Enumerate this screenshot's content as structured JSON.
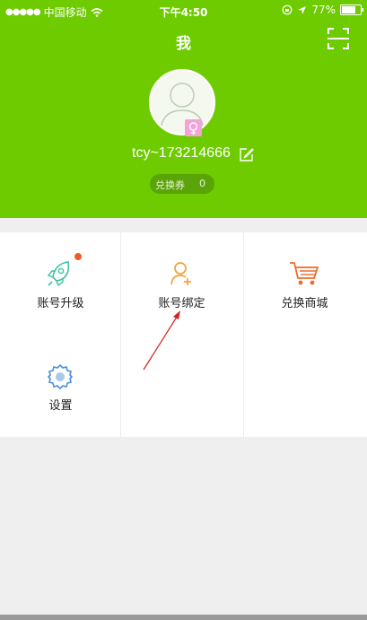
{
  "status_bar": {
    "carrier": "中国移动",
    "time": "下午4:50",
    "battery": "77%",
    "battery_level": 0.77
  },
  "header": {
    "title": "我",
    "username": "tcy~173214666",
    "coupon_label": "兑换券",
    "coupon_value": "0"
  },
  "menu": {
    "items": [
      {
        "label": "账号升级",
        "icon": "rocket-icon",
        "has_badge": true
      },
      {
        "label": "账号绑定",
        "icon": "add-user-icon"
      },
      {
        "label": "兑换商城",
        "icon": "shopping-cart-icon"
      },
      {
        "label": "设置",
        "icon": "gear-icon"
      }
    ]
  },
  "colors": {
    "brand_green": "#6ecb00",
    "coupon_pill": "#5aa308",
    "badge_red": "#f05a28",
    "annotation_arrow": "#d42020"
  }
}
